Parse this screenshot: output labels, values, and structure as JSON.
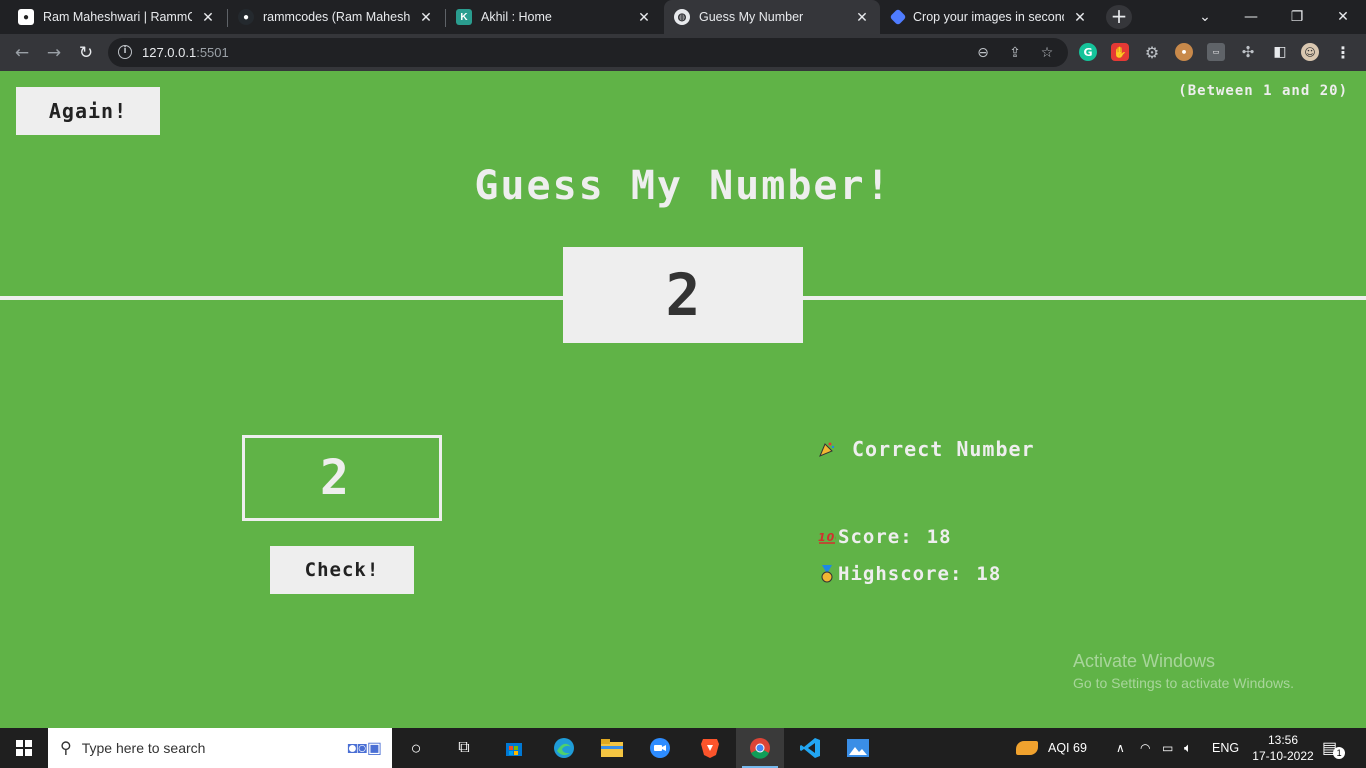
{
  "browser": {
    "tabs": [
      {
        "title": "Ram Maheshwari | RammCodes",
        "active": false
      },
      {
        "title": "rammcodes (Ram Maheshwari)",
        "active": false
      },
      {
        "title": "Akhil : Home",
        "active": false
      },
      {
        "title": "Guess My Number",
        "active": true
      },
      {
        "title": "Crop your images in seconds",
        "active": false
      }
    ],
    "url_host": "127.0.0.1",
    "url_port": ":5501"
  },
  "game": {
    "again_label": "Again!",
    "range_hint": "(Between 1 and 20)",
    "title": "Guess My Number!",
    "secret_number": "2",
    "guess_value": "2",
    "check_label": "Check!",
    "message": "Correct Number",
    "score_label": "Score:",
    "score_value": "18",
    "highscore_label": "Highscore:",
    "highscore_value": "18",
    "background_color": "#60b347"
  },
  "watermark": {
    "line1": "Activate Windows",
    "line2": "Go to Settings to activate Windows."
  },
  "taskbar": {
    "search_placeholder": "Type here to search",
    "aqi": "AQI 69",
    "language": "ENG",
    "time": "13:56",
    "date": "17-10-2022",
    "notification_count": "1"
  }
}
